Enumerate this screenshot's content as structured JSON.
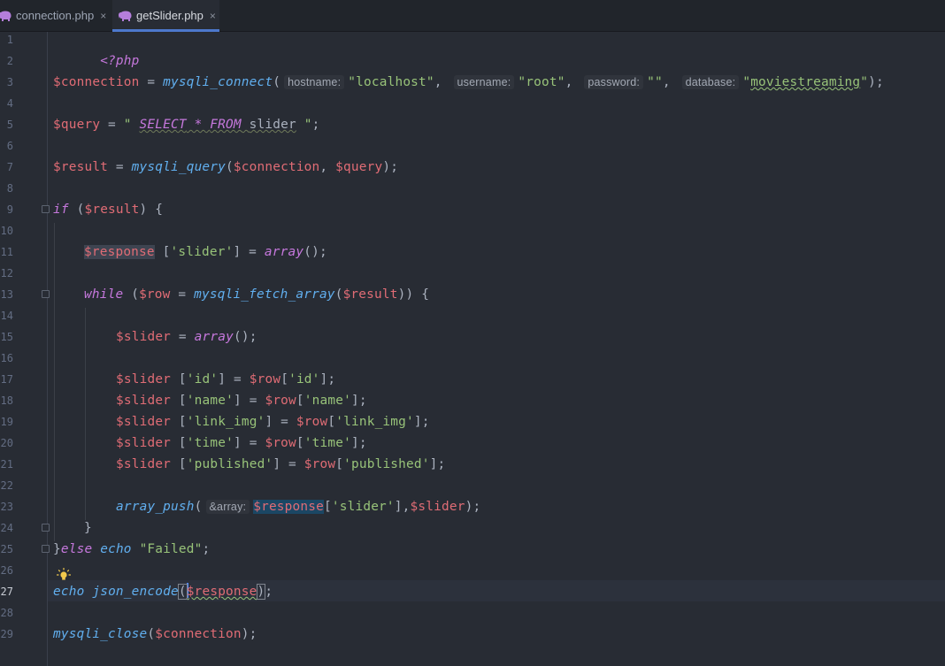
{
  "tabs": [
    {
      "label": "connection.php",
      "close": "×",
      "active": false
    },
    {
      "label": "getSlider.php",
      "close": "×",
      "active": true
    }
  ],
  "editor": {
    "active_line": 27,
    "line_numbers": [
      "1",
      "2",
      "3",
      "4",
      "5",
      "6",
      "7",
      "8",
      "9",
      "10",
      "11",
      "12",
      "13",
      "14",
      "15",
      "16",
      "17",
      "18",
      "19",
      "20",
      "21",
      "22",
      "23",
      "24",
      "25",
      "26",
      "27",
      "28",
      "29"
    ],
    "code": {
      "l1_php_open": "<?php",
      "l3_var": "$connection",
      "l3_eq": " = ",
      "l3_fn": "mysqli_connect",
      "l3_paren": "(",
      "l3_hint_host": "hostname:",
      "l3_host": "\"localhost\"",
      "l3_comma1": ",",
      "l3_hint_user": "username:",
      "l3_user": "\"root\"",
      "l3_comma2": ",",
      "l3_hint_pass": "password:",
      "l3_pass": "\"\"",
      "l3_comma3": ",",
      "l3_hint_db": "database:",
      "l3_db_q1": "\"",
      "l3_db": "moviestreaming",
      "l3_db_q2": "\"",
      "l3_end": ");",
      "l5_var": "$query",
      "l5_eq": " = ",
      "l5_q1": "\" ",
      "l5_select": "SELECT",
      "l5_star": " * ",
      "l5_from": "FROM",
      "l5_sp": " ",
      "l5_table": "slider",
      "l5_q2": " \"",
      "l5_end": ";",
      "l7_var": "$result",
      "l7_eq": " = ",
      "l7_fn": "mysqli_query",
      "l7_paren": "(",
      "l7_a1": "$connection",
      "l7_comma": ", ",
      "l7_a2": "$query",
      "l7_end": ");",
      "l9_if": "if",
      "l9_p1": " (",
      "l9_var": "$result",
      "l9_p2": ") {",
      "l11_var": "$response",
      "l11_b1": " [",
      "l11_key": "'slider'",
      "l11_b2": "] = ",
      "l11_fn": "array",
      "l11_end": "();",
      "l13_while": "while",
      "l13_p1": " (",
      "l13_var": "$row",
      "l13_eq": " = ",
      "l13_fn": "mysqli_fetch_array",
      "l13_p2": "(",
      "l13_arg": "$result",
      "l13_end": ")) {",
      "l15_var": "$slider",
      "l15_eq": " = ",
      "l15_fn": "array",
      "l15_end": "();",
      "l17_var": "$slider",
      "l17_b1": " [",
      "l17_key": "'id'",
      "l17_b2": "] = ",
      "l17_row": "$row",
      "l17_b3": "[",
      "l17_key2": "'id'",
      "l17_end": "];",
      "l18_var": "$slider",
      "l18_b1": " [",
      "l18_key": "'name'",
      "l18_b2": "] = ",
      "l18_row": "$row",
      "l18_b3": "[",
      "l18_key2": "'name'",
      "l18_end": "];",
      "l19_var": "$slider",
      "l19_b1": " [",
      "l19_key": "'link_img'",
      "l19_b2": "] = ",
      "l19_row": "$row",
      "l19_b3": "[",
      "l19_key2": "'link_img'",
      "l19_end": "];",
      "l20_var": "$slider",
      "l20_b1": " [",
      "l20_key": "'time'",
      "l20_b2": "] = ",
      "l20_row": "$row",
      "l20_b3": "[",
      "l20_key2": "'time'",
      "l20_end": "];",
      "l21_var": "$slider",
      "l21_b1": " [",
      "l21_key": "'published'",
      "l21_b2": "] = ",
      "l21_row": "$row",
      "l21_b3": "[",
      "l21_key2": "'published'",
      "l21_end": "];",
      "l23_fn": "array_push",
      "l23_paren": "(",
      "l23_hint": "&array:",
      "l23_var": "$response",
      "l23_b1": "[",
      "l23_key": "'slider'",
      "l23_b2": "],",
      "l23_arg": "$slider",
      "l23_end": ");",
      "l24_brace": "}",
      "l25_brace": "}",
      "l25_else": "else",
      "l25_sp": " ",
      "l25_echo": "echo",
      "l25_sp2": " ",
      "l25_str": "\"Failed\"",
      "l25_end": ";",
      "l27_echo": "echo",
      "l27_sp": " ",
      "l27_fn": "json_encode",
      "l27_p1": "(",
      "l27_var": "$response",
      "l27_p2": ")",
      "l27_end": ";",
      "l29_fn": "mysqli_close",
      "l29_paren": "(",
      "l29_arg": "$connection",
      "l29_end": ");"
    }
  },
  "icons": {
    "php_file": "elephant-icon",
    "intention": "lightbulb-icon"
  },
  "colors": {
    "background": "#282c34",
    "tab_bar": "#21252b",
    "active_tab_underline": "#4d78cc",
    "variable": "#e06c75",
    "keyword": "#c678dd",
    "function": "#61afef",
    "string": "#98c379"
  }
}
